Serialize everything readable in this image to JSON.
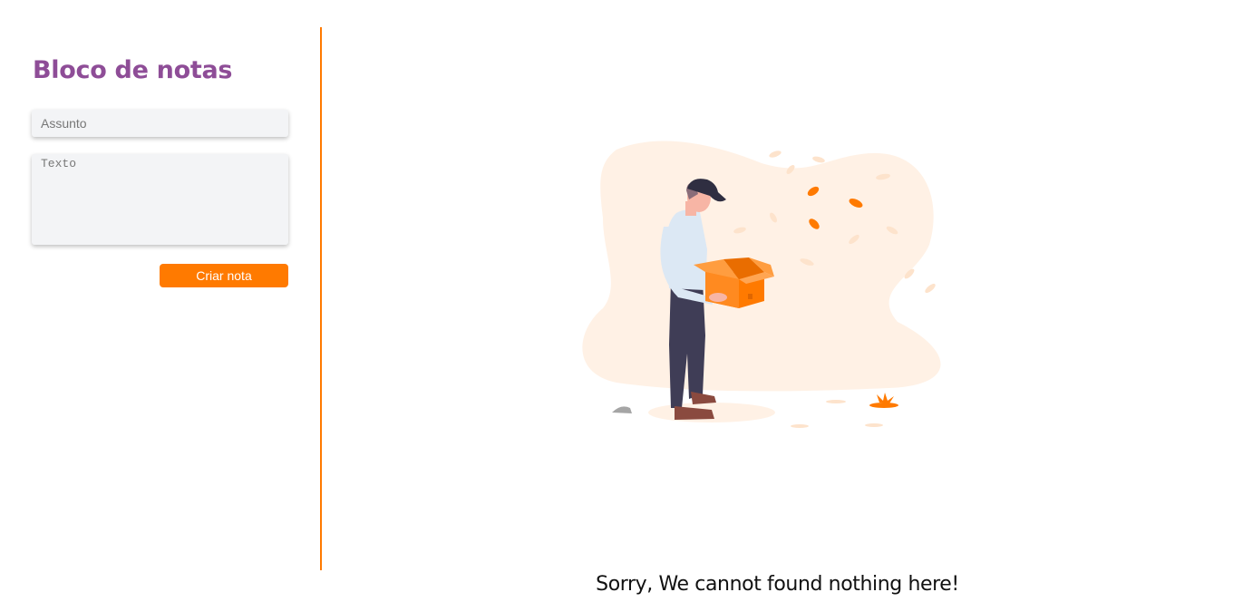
{
  "app": {
    "title": "Bloco de notas"
  },
  "form": {
    "subject_placeholder": "Assunto",
    "subject_value": "",
    "text_placeholder": "Texto",
    "text_value": "",
    "submit_label": "Criar nota"
  },
  "empty_state": {
    "message": "Sorry, We cannot found nothing here!",
    "illustration_icon": "person-holding-empty-box-icon"
  },
  "colors": {
    "accent": "#ff7a00",
    "title": "#8e4d97",
    "input_bg": "#f3f4f6",
    "blob_bg": "#fff1e5"
  }
}
